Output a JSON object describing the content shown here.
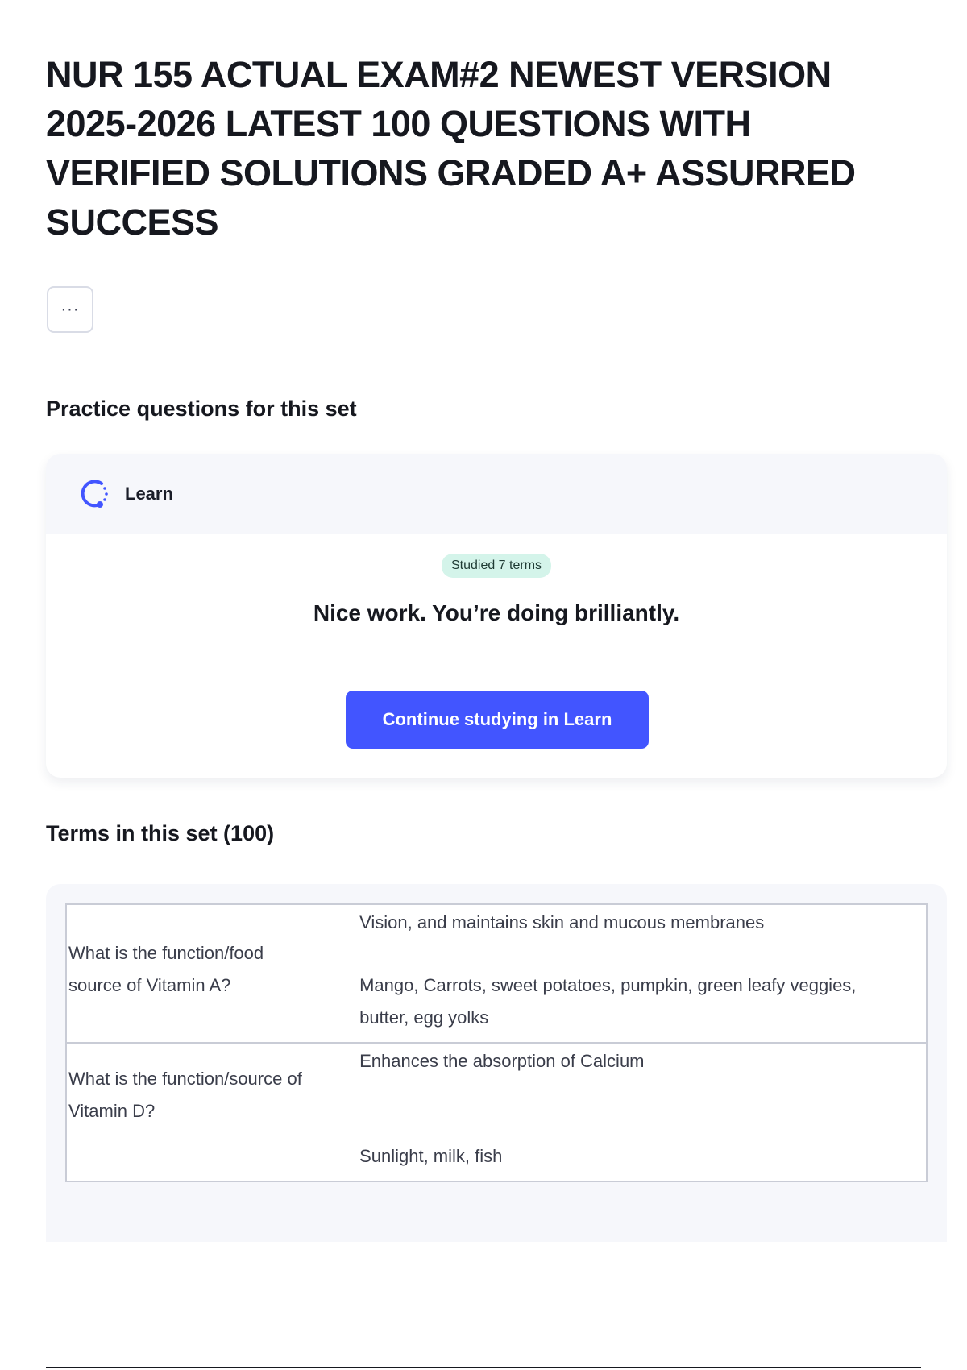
{
  "header": {
    "title": "NUR 155 ACTUAL EXAM#2 NEWEST VERSION 2025-2026 LATEST 100 QUESTIONS WITH VERIFIED SOLUTIONS GRADED A+ ASSURRED SUCCESS",
    "more_options_label": "···"
  },
  "practice": {
    "heading": "Practice questions for this set",
    "card": {
      "mode_icon": "learn-progress-icon",
      "mode_label": "Learn",
      "badge": "Studied 7 terms",
      "message": "Nice work. You’re doing brilliantly.",
      "button_label": "Continue studying in Learn"
    }
  },
  "terms": {
    "heading": "Terms in this set (100)",
    "rows": [
      {
        "term": "What is the function/food source of Vitamin A?",
        "definition_lines": [
          "Vision, and maintains skin and mucous membranes",
          "Mango, Carrots, sweet potatoes, pumpkin, green leafy veggies, butter, egg yolks"
        ]
      },
      {
        "term": "What is the function/source of Vitamin D?",
        "definition_lines": [
          "Enhances the absorption of Calcium",
          "Sunlight, milk, fish"
        ]
      }
    ]
  },
  "colors": {
    "primary_button": "#4255ff",
    "badge_bg": "#d4f4ea",
    "card_header_bg": "#f6f7fb",
    "learn_icon": "#4255ff"
  }
}
